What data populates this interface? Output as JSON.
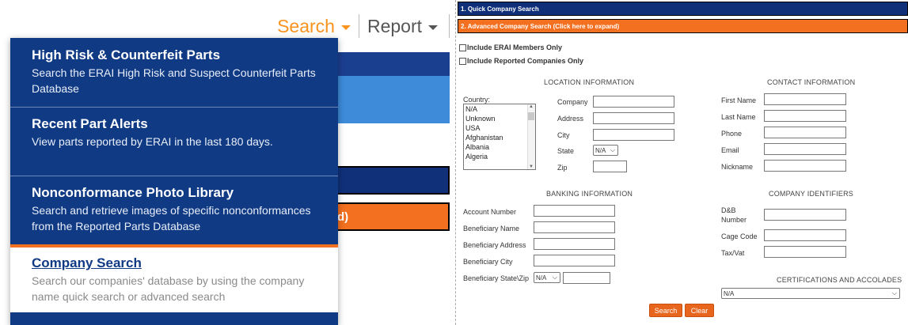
{
  "topnav": {
    "search_label": "Search",
    "report_label": "Report"
  },
  "background": {
    "orange_fragment": "d)"
  },
  "dropdown": [
    {
      "title": "High Risk & Counterfeit Parts",
      "desc": "Search the ERAI High Risk and Suspect Counterfeit Parts Database"
    },
    {
      "title": "Recent Part Alerts",
      "desc": "View parts reported by ERAI in the last 180 days."
    },
    {
      "title": "Nonconformance Photo Library",
      "desc": "Search and retrieve images of specific nonconformances from the Reported Parts Database"
    },
    {
      "title": "Company Search",
      "desc": "Search our companies' database by using the company name quick search or advanced search"
    }
  ],
  "form": {
    "quick_bar": "1. Quick Company Search",
    "advanced_bar": "2. Advanced Company Search (Click here to expand)",
    "chk_members": "Include ERAI Members Only",
    "chk_reported": "Include Reported Companies Only",
    "location_head": "LOCATION INFORMATION",
    "contact_head": "CONTACT INFORMATION",
    "banking_head": "BANKING INFORMATION",
    "identifiers_head": "COMPANY IDENTIFIERS",
    "cert_head": "CERTIFICATIONS AND ACCOLADES",
    "country_label": "Country:",
    "countries": [
      "N/A",
      "Unknown",
      "USA",
      "Afghanistan",
      "Albania",
      "Algeria"
    ],
    "company_label": "Company",
    "address_label": "Address",
    "city_label": "City",
    "state_label": "State",
    "state_value": "N/A",
    "zip_label": "Zip",
    "first_name_label": "First Name",
    "last_name_label": "Last Name",
    "phone_label": "Phone",
    "email_label": "Email",
    "nickname_label": "Nickname",
    "account_label": "Account Number",
    "ben_name_label": "Beneficiary Name",
    "ben_address_label": "Beneficiary Address",
    "ben_city_label": "Beneficiary City",
    "ben_state_label": "Beneficiary State\\Zip",
    "ben_state_value": "N/A",
    "dnb_label_1": "D&B",
    "dnb_label_2": "Number",
    "cage_label": "Cage Code",
    "tax_label": "Tax/Vat",
    "cert_value": "N/A",
    "search_btn": "Search",
    "clear_btn": "Clear"
  }
}
